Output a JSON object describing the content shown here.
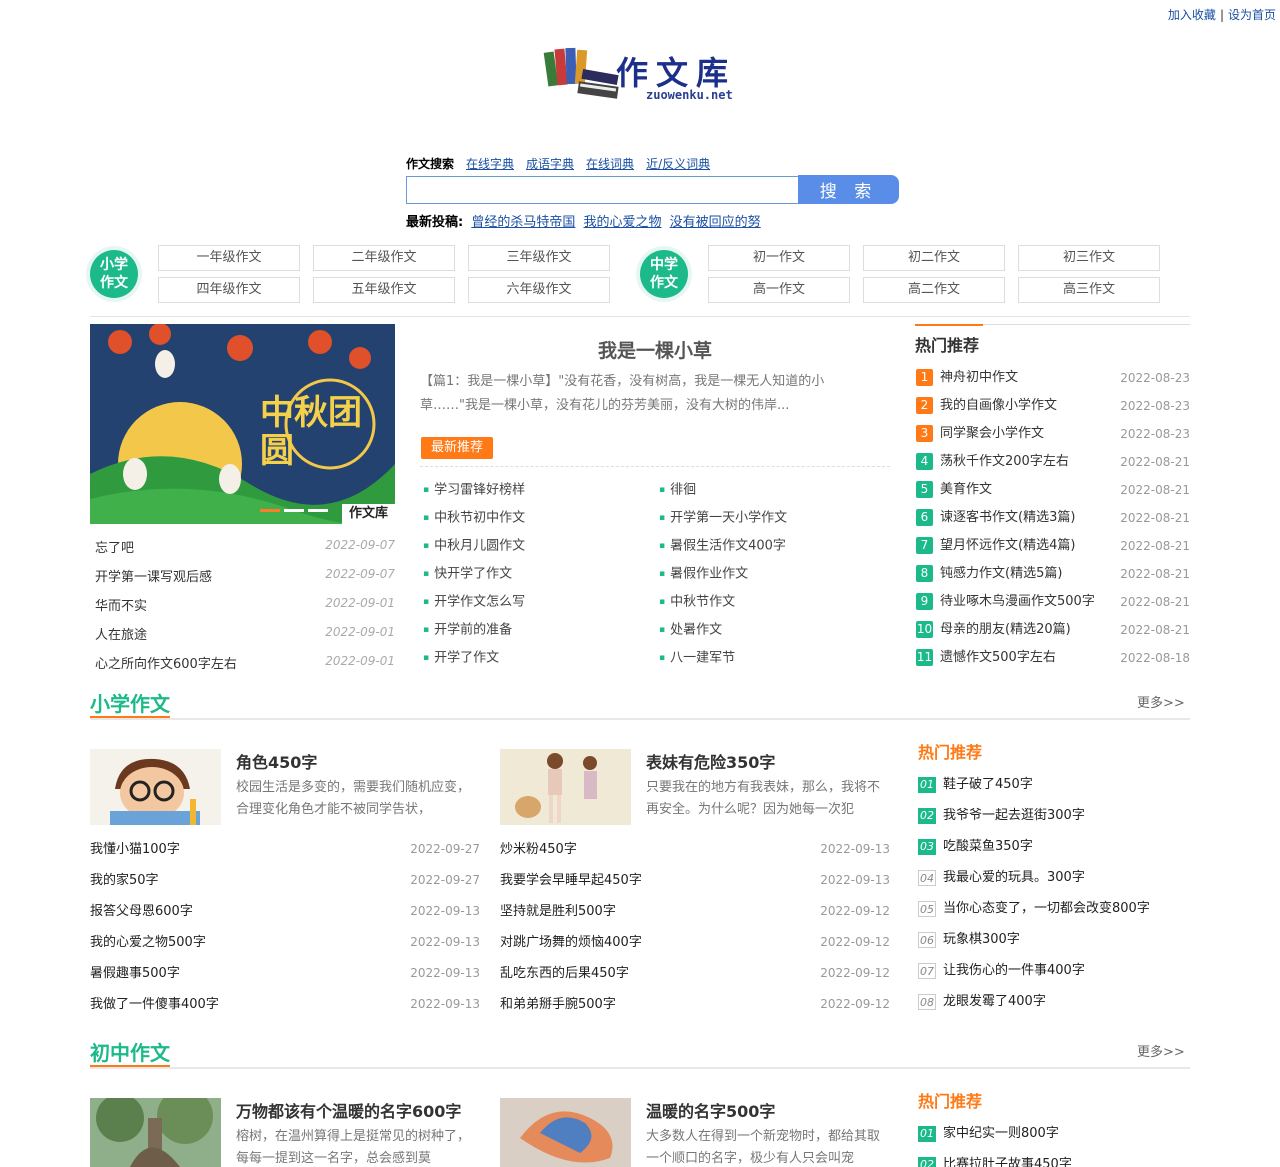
{
  "toplinks": {
    "favorite": "加入收藏",
    "homepage": "设为首页",
    "sep": "|"
  },
  "logo": {
    "cn": "作文库",
    "en": "zuowenku.net"
  },
  "search": {
    "active_tab": "作文搜索",
    "tabs": [
      "在线字典",
      "成语字典",
      "在线词典",
      "近/反义词典"
    ],
    "button": "搜 索",
    "latest_label": "最新投稿:",
    "latest_items": [
      "曾经的杀马特帝国",
      "我的心爱之物",
      "没有被回应的努"
    ]
  },
  "grades": {
    "primary_badge": [
      "小学",
      "作文"
    ],
    "primary": [
      "一年级作文",
      "二年级作文",
      "三年级作文",
      "四年级作文",
      "五年级作文",
      "六年级作文"
    ],
    "middle_badge": [
      "中学",
      "作文"
    ],
    "middle": [
      "初一作文",
      "初二作文",
      "初三作文",
      "高一作文",
      "高二作文",
      "高三作文"
    ]
  },
  "banner": {
    "text": "中秋团圆",
    "watermark": "作文库"
  },
  "left_list": [
    {
      "title": "忘了吧",
      "date": "2022-09-07"
    },
    {
      "title": "开学第一课写观后感",
      "date": "2022-09-07"
    },
    {
      "title": "华而不实",
      "date": "2022-09-01"
    },
    {
      "title": "人在旅途",
      "date": "2022-09-01"
    },
    {
      "title": "心之所向作文600字左右",
      "date": "2022-09-01"
    }
  ],
  "featured": {
    "title": "我是一棵小草",
    "desc": "【篇1：我是一棵小草】\"没有花香，没有树高，我是一棵无人知道的小草……\"我是一棵小草，没有花儿的芬芳美丽，没有大树的伟岸...",
    "tag": "最新推荐",
    "col1": [
      "学习雷锋好榜样",
      "中秋节初中作文",
      "中秋月儿圆作文",
      "快开学了作文",
      "开学作文怎么写",
      "开学前的准备",
      "开学了作文"
    ],
    "col2": [
      "徘徊",
      "开学第一天小学作文",
      "暑假生活作文400字",
      "暑假作业作文",
      "中秋节作文",
      "处暑作文",
      "八一建军节"
    ]
  },
  "hot": {
    "title": "热门推荐",
    "items": [
      {
        "n": "1",
        "title": "神舟初中作文",
        "date": "2022-08-23",
        "color": "#ff7a16"
      },
      {
        "n": "2",
        "title": "我的自画像小学作文",
        "date": "2022-08-23",
        "color": "#ff7a16"
      },
      {
        "n": "3",
        "title": "同学聚会小学作文",
        "date": "2022-08-23",
        "color": "#ff7a16"
      },
      {
        "n": "4",
        "title": "荡秋千作文200字左右",
        "date": "2022-08-21",
        "color": "#1cb98a"
      },
      {
        "n": "5",
        "title": "美育作文",
        "date": "2022-08-21",
        "color": "#1cb98a"
      },
      {
        "n": "6",
        "title": "谏逐客书作文(精选3篇)",
        "date": "2022-08-21",
        "color": "#1cb98a"
      },
      {
        "n": "7",
        "title": "望月怀远作文(精选4篇)",
        "date": "2022-08-21",
        "color": "#1cb98a"
      },
      {
        "n": "8",
        "title": "钝感力作文(精选5篇)",
        "date": "2022-08-21",
        "color": "#1cb98a"
      },
      {
        "n": "9",
        "title": "待业啄木鸟漫画作文500字",
        "date": "2022-08-21",
        "color": "#1cb98a"
      },
      {
        "n": "10",
        "title": "母亲的朋友(精选20篇)",
        "date": "2022-08-21",
        "color": "#1cb98a"
      },
      {
        "n": "11",
        "title": "遗憾作文500字左右",
        "date": "2022-08-18",
        "color": "#1cb98a"
      }
    ]
  },
  "primary": {
    "title": "小学作文",
    "more": "更多>>",
    "card1": {
      "title": "角色450字",
      "desc": "校园生活是多变的，需要我们随机应变，合理变化角色才能不被同学告状，"
    },
    "card2": {
      "title": "表妹有危险350字",
      "desc": "只要我在的地方有我表妹，那么，我将不再安全。为什么呢？因为她每一次犯"
    },
    "list1": [
      {
        "title": "我懂小猫100字",
        "date": "2022-09-27"
      },
      {
        "title": "我的家50字",
        "date": "2022-09-27"
      },
      {
        "title": "报答父母恩600字",
        "date": "2022-09-13"
      },
      {
        "title": "我的心爱之物500字",
        "date": "2022-09-13"
      },
      {
        "title": "暑假趣事500字",
        "date": "2022-09-13"
      },
      {
        "title": "我做了一件傻事400字",
        "date": "2022-09-13"
      }
    ],
    "list2": [
      {
        "title": "炒米粉450字",
        "date": "2022-09-13"
      },
      {
        "title": "我要学会早睡早起450字",
        "date": "2022-09-13"
      },
      {
        "title": "坚持就是胜利500字",
        "date": "2022-09-12"
      },
      {
        "title": "对跳广场舞的烦恼400字",
        "date": "2022-09-12"
      },
      {
        "title": "乱吃东西的后果450字",
        "date": "2022-09-12"
      },
      {
        "title": "和弟弟掰手腕500字",
        "date": "2022-09-12"
      }
    ],
    "hot_title": "热门推荐",
    "hot": [
      {
        "n": "01",
        "title": "鞋子破了450字"
      },
      {
        "n": "02",
        "title": "我爷爷一起去逛街300字"
      },
      {
        "n": "03",
        "title": "吃酸菜鱼350字"
      },
      {
        "n": "04",
        "title": "我最心爱的玩具。300字"
      },
      {
        "n": "05",
        "title": "当你心态变了，一切都会改变800字"
      },
      {
        "n": "06",
        "title": "玩象棋300字"
      },
      {
        "n": "07",
        "title": "让我伤心的一件事400字"
      },
      {
        "n": "08",
        "title": "龙眼发霉了400字"
      }
    ]
  },
  "middle": {
    "title": "初中作文",
    "more": "更多>>",
    "card1": {
      "title": "万物都该有个温暖的名字600字",
      "desc": "榕树，在温州算得上是挺常见的树种了，每每一提到这一名字，总会感到莫"
    },
    "card2": {
      "title": "温暖的名字500字",
      "desc": "大多数人在得到一个新宠物时，都给其取一个顺口的名字，极少有人只会叫宠"
    },
    "hot_title": "热门推荐",
    "hot": [
      {
        "n": "01",
        "title": "家中纪实一则800字"
      },
      {
        "n": "02",
        "title": "比赛拉肚子故事450字"
      }
    ]
  }
}
